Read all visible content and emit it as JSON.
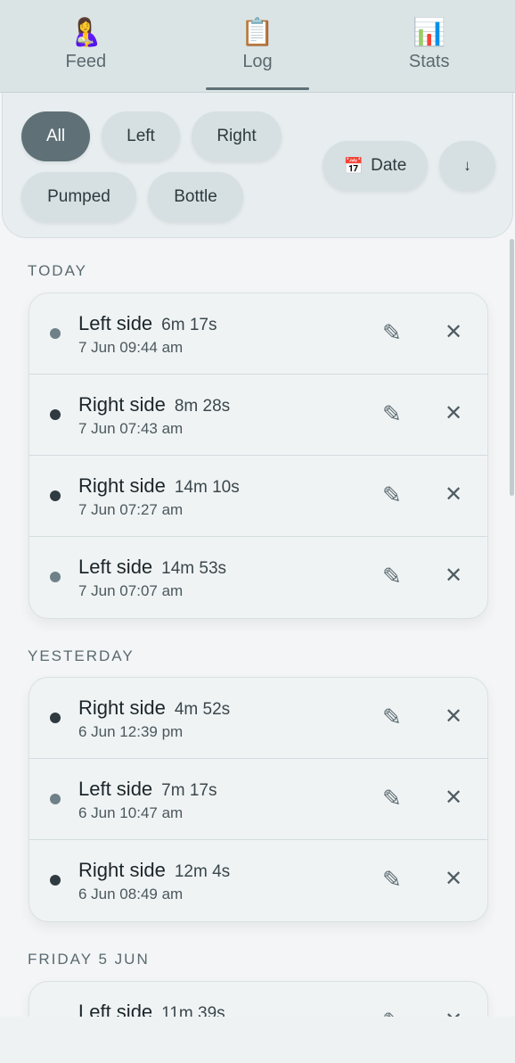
{
  "tabs": [
    {
      "icon": "breastfeeding-icon",
      "emoji": "🤱",
      "label": "Feed"
    },
    {
      "icon": "clipboard-icon",
      "emoji": "📋",
      "label": "Log"
    },
    {
      "icon": "bar-chart-icon",
      "emoji": "📊",
      "label": "Stats"
    }
  ],
  "active_tab": "Log",
  "filters": {
    "all": "All",
    "left": "Left",
    "right": "Right",
    "pumped": "Pumped",
    "bottle": "Bottle",
    "selected": "All",
    "sort_emoji": "📅",
    "sort_label": "Date",
    "sort_direction": "↓"
  },
  "icons": {
    "edit": "✎",
    "delete": "✕"
  },
  "colors": {
    "accent": "#5f7177",
    "left_dot": "#6f8188",
    "right_dot": "#2f3b40"
  },
  "sections": [
    {
      "label": "TODAY",
      "entries": [
        {
          "side": "left",
          "title": "Left side",
          "duration": "6m 17s",
          "time": "7 Jun 09:44 am"
        },
        {
          "side": "right",
          "title": "Right side",
          "duration": "8m 28s",
          "time": "7 Jun 07:43 am"
        },
        {
          "side": "right",
          "title": "Right side",
          "duration": "14m 10s",
          "time": "7 Jun 07:27 am"
        },
        {
          "side": "left",
          "title": "Left side",
          "duration": "14m 53s",
          "time": "7 Jun 07:07 am"
        }
      ]
    },
    {
      "label": "YESTERDAY",
      "entries": [
        {
          "side": "right",
          "title": "Right side",
          "duration": "4m 52s",
          "time": "6 Jun 12:39 pm"
        },
        {
          "side": "left",
          "title": "Left side",
          "duration": "7m 17s",
          "time": "6 Jun 10:47 am"
        },
        {
          "side": "right",
          "title": "Right side",
          "duration": "12m 4s",
          "time": "6 Jun 08:49 am"
        }
      ]
    },
    {
      "label": "FRIDAY 5 JUN",
      "entries": [
        {
          "side": "left",
          "title": "Left side",
          "duration": "11m 39s",
          "time": ""
        }
      ]
    }
  ]
}
